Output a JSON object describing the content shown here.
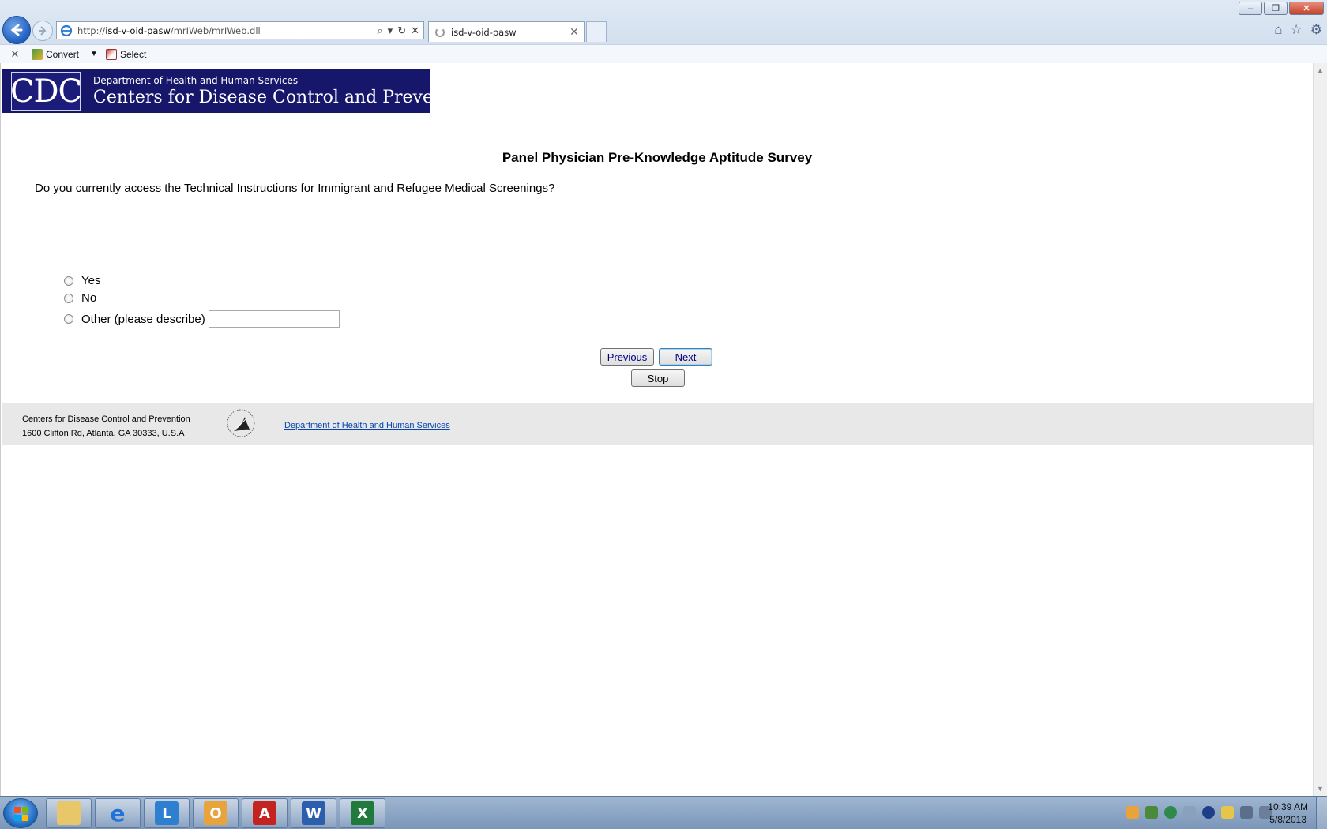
{
  "browser": {
    "url_prefix": "http://",
    "url_host": "isd-v-oid-pasw",
    "url_path": "/mrIWeb/mrIWeb.dll",
    "tab_title": "isd-v-oid-pasw",
    "command_bar": {
      "convert_label": "Convert",
      "select_label": "Select"
    }
  },
  "banner": {
    "logo_text": "CDC",
    "department": "Department of Health and Human Services",
    "agency": "Centers for Disease Control and Prevention"
  },
  "survey": {
    "title": "Panel Physician Pre-Knowledge Aptitude Survey",
    "question": "Do you currently access the Technical Instructions for Immigrant and Refugee Medical Screenings?",
    "options": [
      {
        "label": "Yes"
      },
      {
        "label": "No"
      },
      {
        "label": "Other (please describe)"
      }
    ],
    "other_value": "",
    "buttons": {
      "previous": "Previous",
      "next": "Next",
      "stop": "Stop"
    }
  },
  "footer": {
    "org_name": "Centers for Disease Control and Prevention",
    "address": "1600 Clifton Rd, Atlanta, GA 30333, U.S.A",
    "link": "Department of Health and Human Services"
  },
  "taskbar": {
    "time": "10:39 AM",
    "date": "5/8/2013"
  },
  "colors": {
    "cdc_banner": "#16166b",
    "link": "#0645ad",
    "footer_bg": "#e8e8e8"
  }
}
